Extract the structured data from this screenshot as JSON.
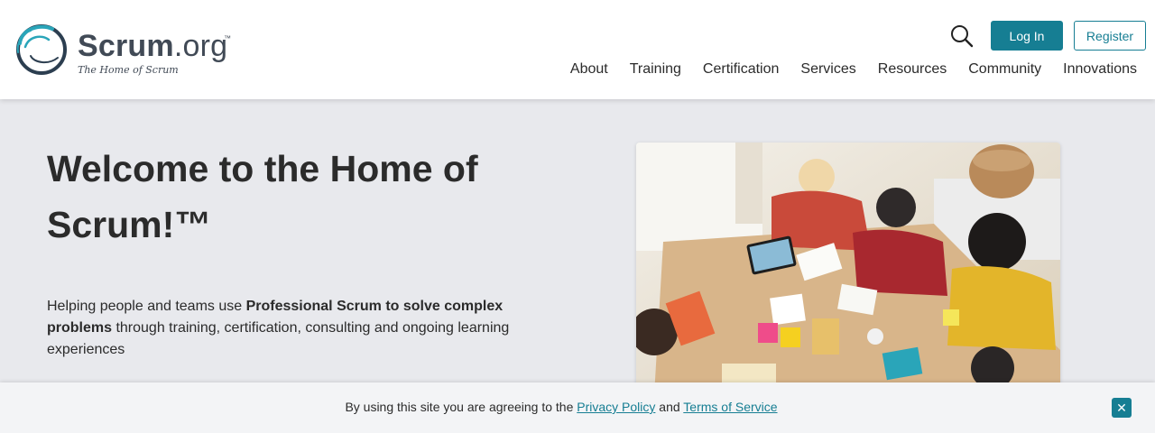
{
  "brand": {
    "name_bold": "Scrum",
    "name_light": ".org",
    "trademark": "™",
    "tagline": "The Home of Scrum"
  },
  "header": {
    "search_icon": "search-icon",
    "login_label": "Log In",
    "register_label": "Register",
    "accent_color": "#167e93"
  },
  "nav": {
    "items": [
      "About",
      "Training",
      "Certification",
      "Services",
      "Resources",
      "Community",
      "Innovations"
    ]
  },
  "hero": {
    "title": "Welcome to the Home of Scrum!™",
    "text_before": "Helping people and teams use ",
    "text_bold": "Professional Scrum to solve complex problems",
    "text_after": " through training, certification, consulting and ongoing learning experiences",
    "image_alt": "team-collaboration-photo"
  },
  "cookie_banner": {
    "text_before": "By using this site you are agreeing to the ",
    "privacy_link": "Privacy Policy",
    "text_middle": " and ",
    "terms_link": "Terms of Service",
    "close_label": "✕"
  }
}
